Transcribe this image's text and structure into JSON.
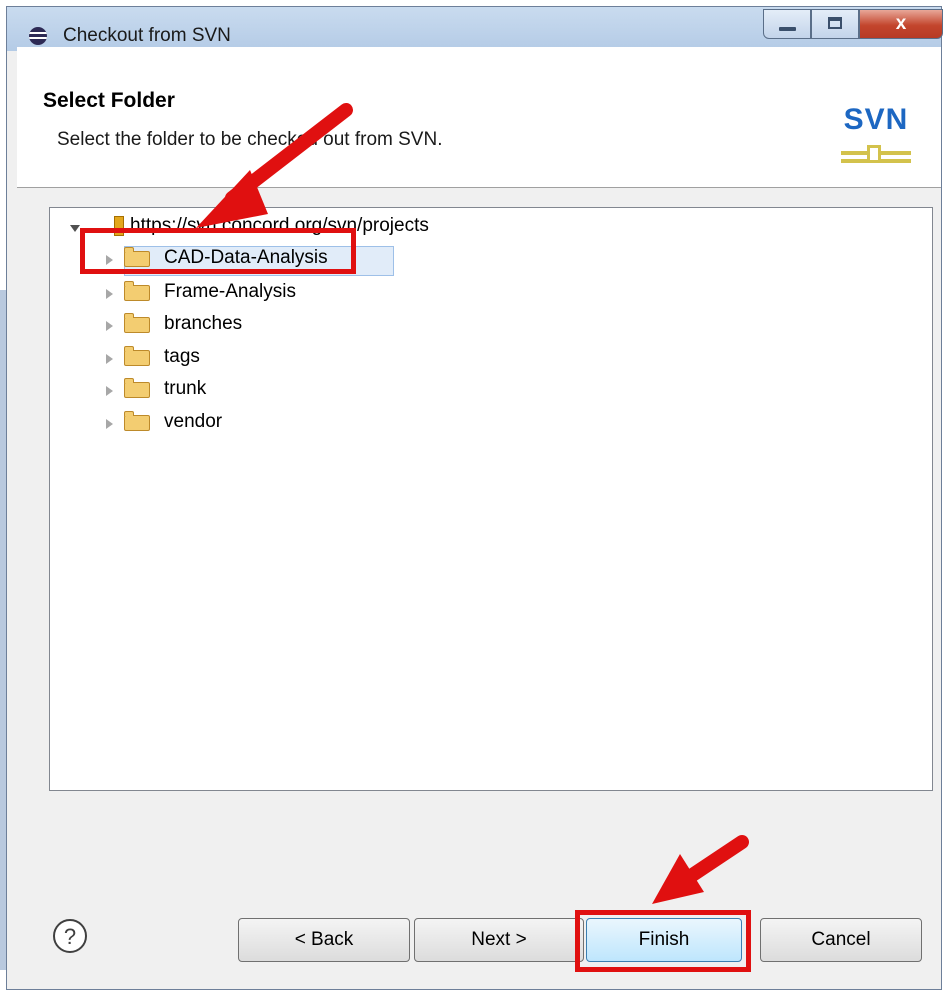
{
  "window": {
    "title": "Checkout from SVN",
    "close_glyph": "x",
    "icons": [
      "eclipse-icon",
      "minimize-icon",
      "maximize-icon",
      "close-icon"
    ]
  },
  "banner": {
    "title": "Select Folder",
    "description": "Select the folder to be checked out from SVN.",
    "logo_text": "SVN"
  },
  "tree": {
    "root": "https://svn.concord.org/svn/projects",
    "folders": [
      {
        "label": "CAD-Data-Analysis",
        "selected": true
      },
      {
        "label": "Frame-Analysis",
        "selected": false
      },
      {
        "label": "branches",
        "selected": false
      },
      {
        "label": "tags",
        "selected": false
      },
      {
        "label": "trunk",
        "selected": false
      },
      {
        "label": "vendor",
        "selected": false
      }
    ]
  },
  "buttons": {
    "help_glyph": "?",
    "back": "< Back",
    "next": "Next >",
    "finish": "Finish",
    "cancel": "Cancel"
  },
  "annotations": {
    "highlight_color": "#e01010"
  }
}
